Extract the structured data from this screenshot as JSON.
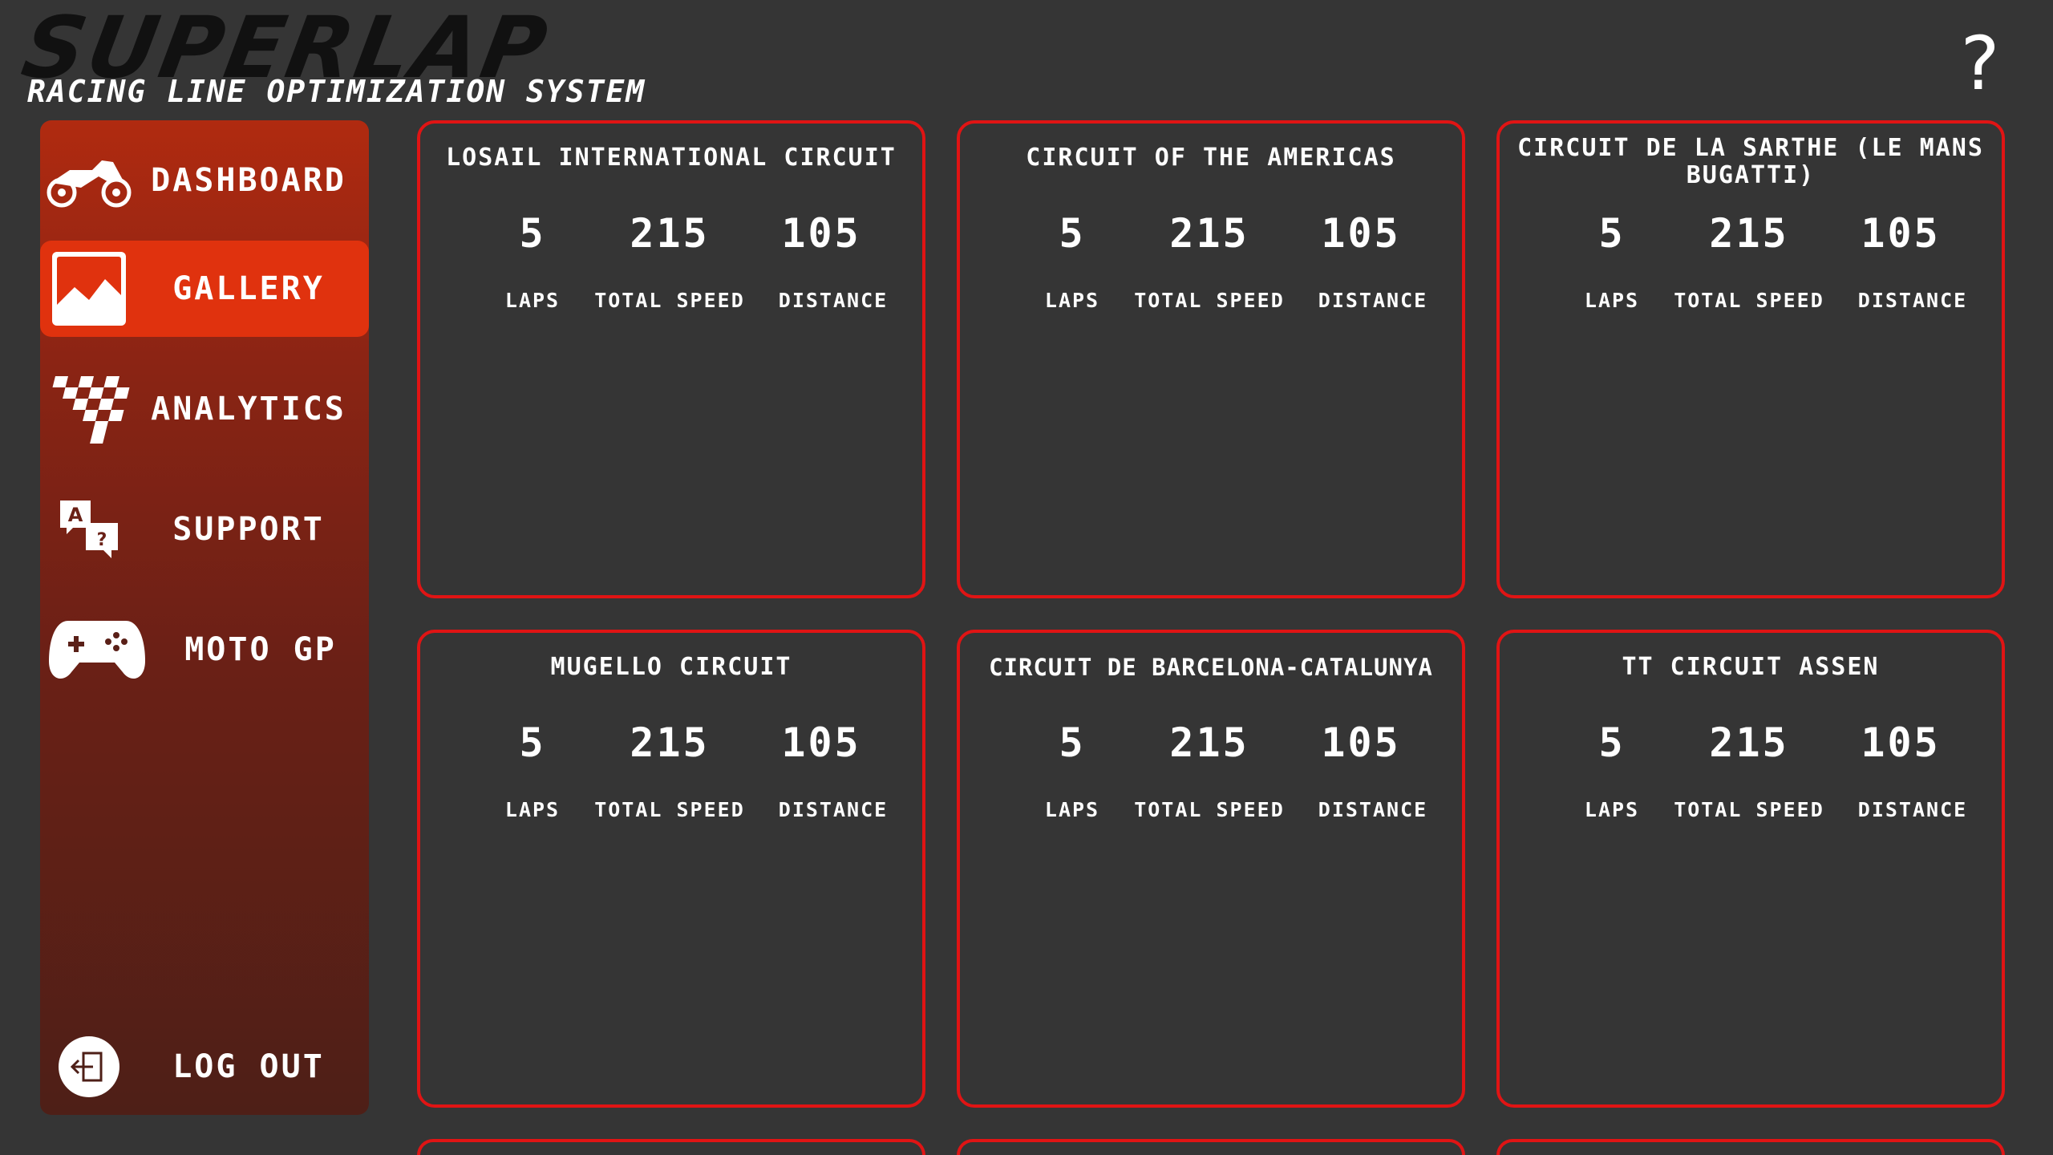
{
  "header": {
    "logo": "SUPERLAP",
    "tagline": "RACING LINE OPTIMIZATION SYSTEM",
    "help_icon": "?"
  },
  "sidebar": {
    "items": [
      {
        "label": "DASHBOARD",
        "icon": "motorcycle-icon",
        "active": false
      },
      {
        "label": "GALLERY",
        "icon": "image-icon",
        "active": true
      },
      {
        "label": "ANALYTICS",
        "icon": "checkered-flag-icon",
        "active": false
      },
      {
        "label": "SUPPORT",
        "icon": "chat-question-icon",
        "active": false
      },
      {
        "label": "MOTO GP",
        "icon": "gamepad-icon",
        "active": false
      }
    ],
    "logout": {
      "label": "LOG OUT",
      "icon": "logout-icon"
    }
  },
  "cards": [
    {
      "title": "LOSAIL INTERNATIONAL CIRCUIT",
      "laps": "5",
      "total_speed": "215",
      "distance": "105"
    },
    {
      "title": "CIRCUIT OF THE AMERICAS",
      "laps": "5",
      "total_speed": "215",
      "distance": "105"
    },
    {
      "title": "CIRCUIT DE LA SARTHE (LE MANS BUGATTI)",
      "laps": "5",
      "total_speed": "215",
      "distance": "105"
    },
    {
      "title": "MUGELLO CIRCUIT",
      "laps": "5",
      "total_speed": "215",
      "distance": "105"
    },
    {
      "title": "CIRCUIT DE BARCELONA-CATALUNYA",
      "laps": "5",
      "total_speed": "215",
      "distance": "105"
    },
    {
      "title": "TT CIRCUIT ASSEN",
      "laps": "5",
      "total_speed": "215",
      "distance": "105"
    }
  ],
  "stat_labels": {
    "laps": "LAPS",
    "total_speed": "TOTAL SPEED",
    "distance": "DISTANCE"
  },
  "colors": {
    "accent": "#e0320e",
    "card_border": "#e01414",
    "background": "#353535"
  }
}
